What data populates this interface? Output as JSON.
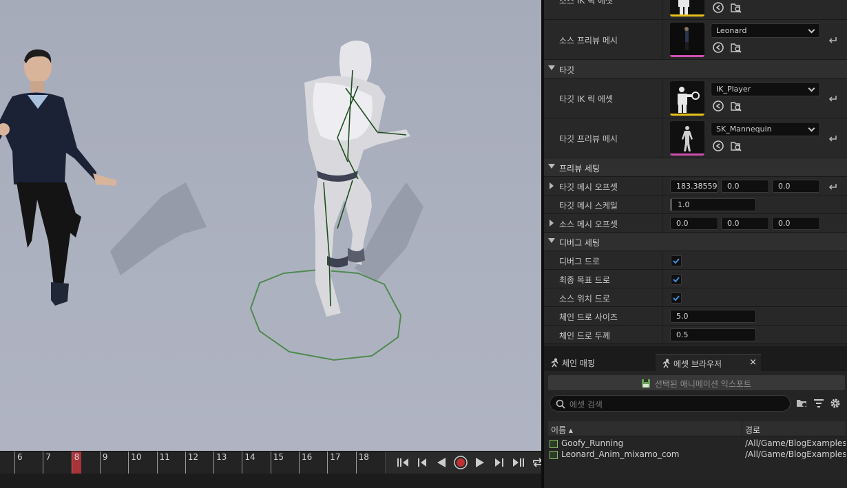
{
  "details": {
    "source_ik_rig_label": "소스 IK 릭 에셋",
    "source_preview_mesh": {
      "label": "소스 프리뷰 메시",
      "value": "Leonard"
    },
    "target_section": "타깃",
    "target_ik_rig": {
      "label": "타깃 IK 릭 에셋",
      "value": "IK_Player"
    },
    "target_preview_mesh": {
      "label": "타깃 프리뷰 메시",
      "value": "SK_Mannequin"
    },
    "preview_section": "프리뷰 세팅",
    "target_mesh_offset": {
      "label": "타깃 메시 오프셋",
      "x": "183.38559",
      "y": "0.0",
      "z": "0.0"
    },
    "target_mesh_scale": {
      "label": "타깃 메시 스케일",
      "value": "1.0"
    },
    "source_mesh_offset": {
      "label": "소스 메시 오프셋",
      "x": "0.0",
      "y": "0.0",
      "z": "0.0"
    },
    "debug_section": "디버그 세팅",
    "debug_draw": {
      "label": "디버그 드로",
      "checked": true
    },
    "final_goal_draw": {
      "label": "최종 목표 드로",
      "checked": true
    },
    "source_location_draw": {
      "label": "소스 위치 드로",
      "checked": true
    },
    "chain_draw_size": {
      "label": "체인 드로 사이즈",
      "value": "5.0"
    },
    "chain_draw_thickness": {
      "label": "체인 드로 두께",
      "value": "0.5"
    }
  },
  "tabs": [
    {
      "label": "체인 매핑",
      "active": false
    },
    {
      "label": "에셋 브라우저",
      "active": true,
      "close": "×"
    }
  ],
  "asset_browser": {
    "export_label": "선택된 애니메이션 익스포트",
    "search_placeholder": "에셋 검색",
    "columns": {
      "name": "이름 ▴",
      "path": "경로"
    },
    "rows": [
      {
        "name": "Goofy_Running",
        "path": "/All/Game/BlogExamples"
      },
      {
        "name": "Leonard_Anim_mixamo_com",
        "path": "/All/Game/BlogExamples"
      }
    ]
  },
  "timeline": {
    "frames": [
      "6",
      "7",
      "8",
      "9",
      "10",
      "11",
      "12",
      "13",
      "14",
      "15",
      "16",
      "17",
      "18"
    ],
    "current_frame": "8"
  },
  "colors": {
    "ik_rig_bar": "#e8c21a",
    "mesh_bar": "#d050b0",
    "checkbox": "#3b8ee0",
    "record": "#c03030",
    "debug_chain": "#1d4d1d",
    "goal_circle": "#4f8a4f"
  },
  "icons": {
    "browse": "browse-asset-icon",
    "find": "find-in-browser-icon",
    "reset": "reset-to-default-icon"
  }
}
